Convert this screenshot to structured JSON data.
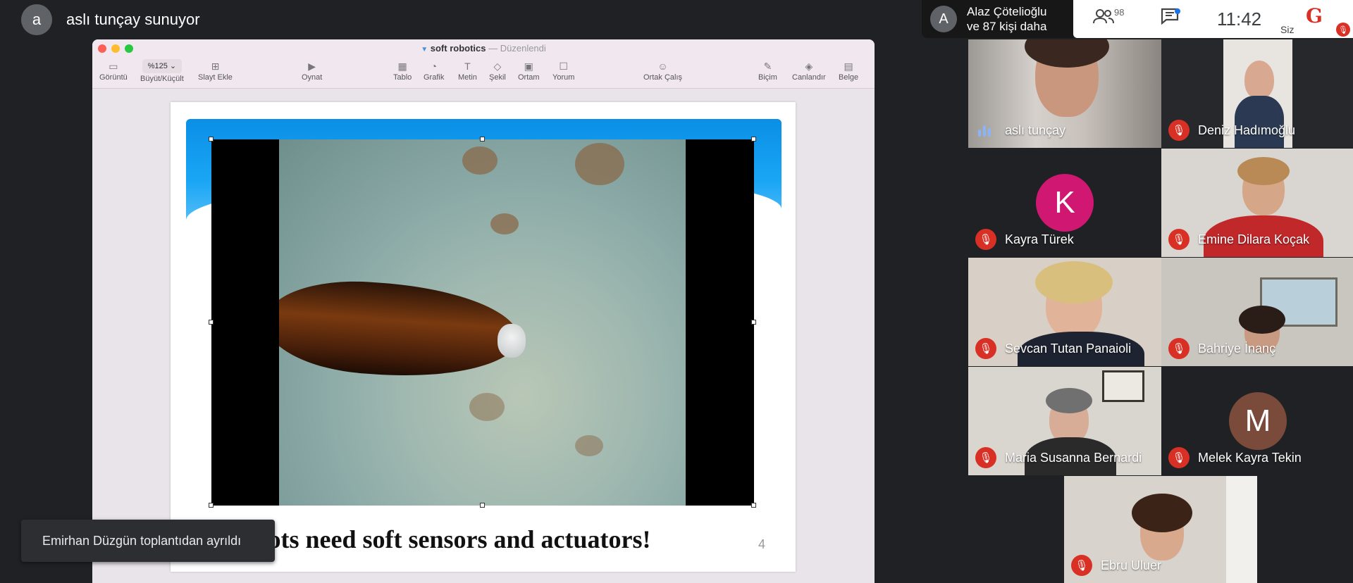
{
  "presenter": {
    "initial": "a",
    "text": "aslı tunçay sunuyor"
  },
  "keynote": {
    "doc_title": "soft robotics",
    "separator": "—",
    "status": "Düzenlendi",
    "toolbar": {
      "view": "Görüntü",
      "zoom_value": "%125",
      "zoom_label": "Büyüt/Küçült",
      "add_slide": "Slayt Ekle",
      "play": "Oynat",
      "table": "Tablo",
      "chart": "Grafik",
      "text": "Metin",
      "shape": "Şekil",
      "media": "Ortam",
      "comment": "Yorum",
      "collaborate": "Ortak Çalış",
      "format": "Biçim",
      "animate": "Canlandır",
      "document": "Belge"
    },
    "slide": {
      "caption": "ots need soft sensors and actuators!",
      "number": "4"
    }
  },
  "toast": "Emirhan Düzgün toplantıdan ayrıldı",
  "others": {
    "initial": "A",
    "line1": "Alaz Çötelioğlu",
    "line2": "ve 87 kişi daha"
  },
  "info_bar": {
    "people_count": "98",
    "time": "11:42",
    "self_label": "Siz"
  },
  "participants": [
    {
      "name": "aslı tunçay",
      "muted": false
    },
    {
      "name": "Deniz Hadımoğlu",
      "muted": true
    },
    {
      "name": "Kayra Türek",
      "muted": true,
      "initial": "K",
      "color": "#d01872"
    },
    {
      "name": "Emine Dilara Koçak",
      "muted": true
    },
    {
      "name": "Sevcan Tutan Panaioli",
      "muted": true
    },
    {
      "name": "Bahriye İnanç",
      "muted": true
    },
    {
      "name": "Maria Susanna Bernardi",
      "muted": true
    },
    {
      "name": "Melek Kayra Tekin",
      "muted": true,
      "initial": "M",
      "color": "#7a4a3a"
    },
    {
      "name": "Ebru Uluer",
      "muted": true
    }
  ]
}
